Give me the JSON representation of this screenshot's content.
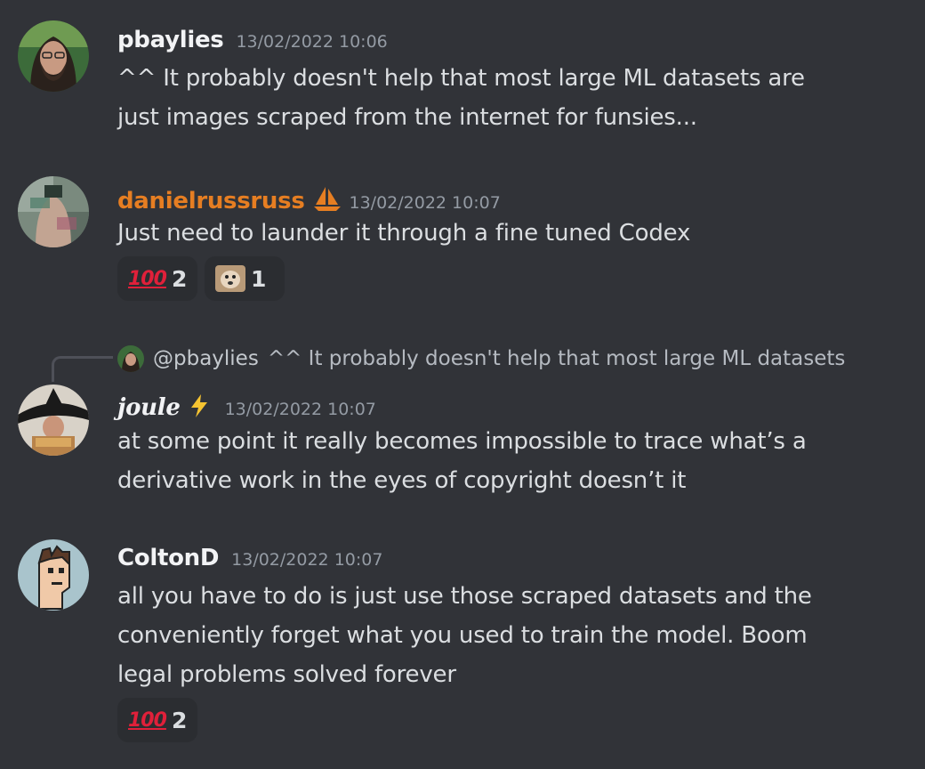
{
  "messages": [
    {
      "username": "pbaylies",
      "timestamp": "13/02/2022 10:06",
      "lines": [
        "^^ It probably doesn't help that most large ML datasets are",
        "just images scraped from the internet for funsies..."
      ]
    },
    {
      "username": "danielrussruss",
      "timestamp": "13/02/2022 10:07",
      "username_color": "#e67e22",
      "lines": [
        "Just need to launder it through a fine tuned Codex"
      ],
      "reactions": [
        {
          "emoji": "100",
          "count": "2"
        },
        {
          "emoji": "dog-sticker",
          "count": "1"
        }
      ]
    },
    {
      "reply_to": {
        "username": "@pbaylies",
        "text": "^^ It probably doesn't help that most large ML datasets"
      },
      "username": "joule",
      "timestamp": "13/02/2022 10:07",
      "lines": [
        "at some point it really becomes impossible to trace what’s a",
        "derivative work in the eyes of copyright doesn’t it"
      ]
    },
    {
      "username": "ColtonD",
      "timestamp": "13/02/2022 10:07",
      "lines": [
        "all you have to do is just use those scraped datasets and the",
        "conveniently forget what you used to train the model. Boom",
        "legal problems solved forever"
      ],
      "reactions": [
        {
          "emoji": "100",
          "count": "2"
        }
      ]
    }
  ],
  "colors": {
    "background": "#313338",
    "reaction_bg": "#2b2d31",
    "accent_orange": "#e67e22"
  }
}
